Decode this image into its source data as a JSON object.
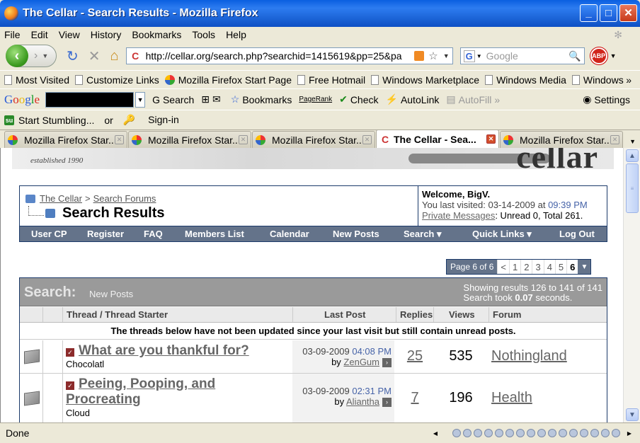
{
  "window": {
    "title": "The Cellar - Search Results - Mozilla Firefox",
    "controls": {
      "minimize": "_",
      "maximize": "□",
      "close": "✕"
    }
  },
  "menu": [
    "File",
    "Edit",
    "View",
    "History",
    "Bookmarks",
    "Tools",
    "Help"
  ],
  "nav": {
    "url": "http://cellar.org/search.php?searchid=1415619&pp=25&pa",
    "search_placeholder": "Google",
    "abp_label": "ABP"
  },
  "bookmarks": [
    "Most Visited",
    "Customize Links",
    "Mozilla Firefox Start Page",
    "Free Hotmail",
    "Windows Marketplace",
    "Windows Media",
    "Windows"
  ],
  "google_toolbar": {
    "search": "Search",
    "bookmarks": "Bookmarks",
    "pagerank": "PageRank",
    "check": "Check",
    "autolink": "AutoLink",
    "autofill": "AutoFill",
    "settings": "Settings"
  },
  "stumble": {
    "start": "Start Stumbling...",
    "or": "or",
    "signin": "Sign-in"
  },
  "tabs": [
    {
      "label": "Mozilla Firefox Star...",
      "active": false
    },
    {
      "label": "Mozilla Firefox Star...",
      "active": false
    },
    {
      "label": "Mozilla Firefox Star...",
      "active": false
    },
    {
      "label": "The Cellar - Sea...",
      "active": true
    },
    {
      "label": "Mozilla Firefox Star...",
      "active": false
    }
  ],
  "page": {
    "banner": {
      "established": "established 1990",
      "logo": "cellar"
    },
    "breadcrumb": {
      "home": "The Cellar",
      "sep": ">",
      "link": "Search Forums"
    },
    "title": "Search Results",
    "welcome": {
      "greeting": "Welcome, BigV.",
      "last_visit_prefix": "You last visited:",
      "last_visit_date": "03-14-2009",
      "at": "at",
      "last_visit_time": "09:39 PM",
      "pm_label": "Private Messages",
      "pm_counts": ": Unread 0, Total 261."
    },
    "navlinks": [
      "User CP",
      "Register",
      "FAQ",
      "Members List",
      "Calendar",
      "New Posts",
      "Search ▾",
      "Quick Links ▾",
      "Log Out"
    ],
    "pager": {
      "label": "Page 6 of 6",
      "prev": "<",
      "pages": [
        "1",
        "2",
        "3",
        "4",
        "5",
        "6"
      ],
      "current": "6"
    },
    "results": {
      "title": "Search:",
      "subtitle": "New Posts",
      "showing": "Showing results 126 to 141 of 141",
      "took_prefix": "Search took",
      "took_value": "0.07",
      "took_suffix": "seconds.",
      "columns": {
        "thread": "Thread / Thread Starter",
        "last_post": "Last Post",
        "replies": "Replies",
        "views": "Views",
        "forum": "Forum"
      },
      "notice": "The threads below have not been updated since your last visit but still contain unread posts.",
      "rows": [
        {
          "title": "What are you thankful for?",
          "starter": "Chocolatl",
          "date": "03-09-2009",
          "time": "04:08 PM",
          "by": "by",
          "user": "ZenGum",
          "replies": "25",
          "views": "535",
          "forum": "Nothingland"
        },
        {
          "title": "Peeing, Pooping, and Procreating",
          "starter": "Cloud",
          "date": "03-09-2009",
          "time": "02:31 PM",
          "by": "by",
          "user": "Aliantha",
          "replies": "7",
          "views": "196",
          "forum": "Health"
        }
      ]
    }
  },
  "status": "Done"
}
